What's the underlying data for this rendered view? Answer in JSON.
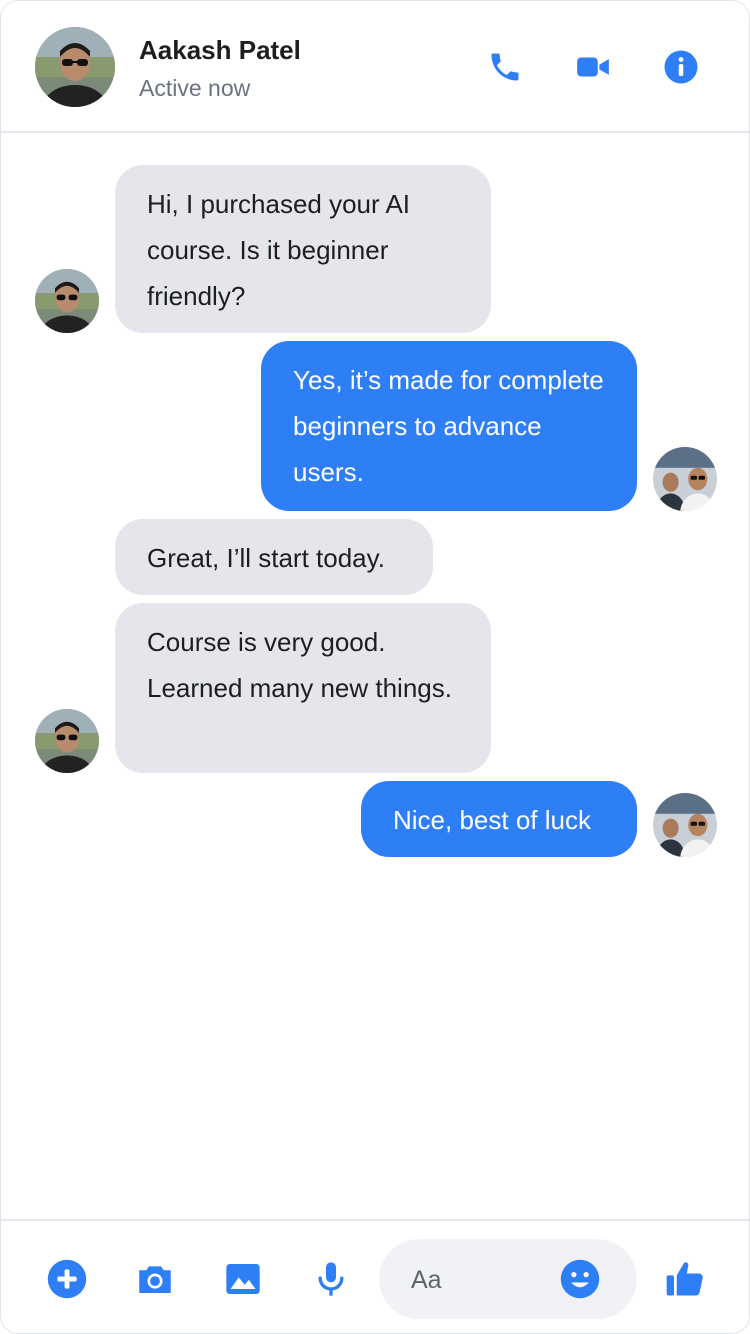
{
  "contact": {
    "name": "Aakash Patel",
    "status": "Active now"
  },
  "header_actions": [
    "phone-icon",
    "video-camera-icon",
    "info-icon"
  ],
  "messages": [
    {
      "direction": "incoming",
      "text": "Hi, I purchased your AI course. Is it beginner friendly?"
    },
    {
      "direction": "outgoing",
      "text": "Yes, it’s made for complete beginners to advance users."
    },
    {
      "direction": "incoming",
      "text": "Great, I’ll start today."
    },
    {
      "direction": "incoming",
      "text": "Course is very good. Learned many new things."
    },
    {
      "direction": "outgoing",
      "text": "Nice, best of luck"
    }
  ],
  "composer": {
    "placeholder": "Aa"
  },
  "footer_actions": [
    "plus-icon",
    "camera-icon",
    "image-icon",
    "microphone-icon",
    "emoji-icon",
    "thumbs-up-icon"
  ],
  "colors": {
    "accent": "#2e7ff6",
    "incoming_bubble": "#e4e6eb",
    "outgoing_bubble": "#2e7ff6",
    "composer_bg": "#f0f2f5"
  }
}
